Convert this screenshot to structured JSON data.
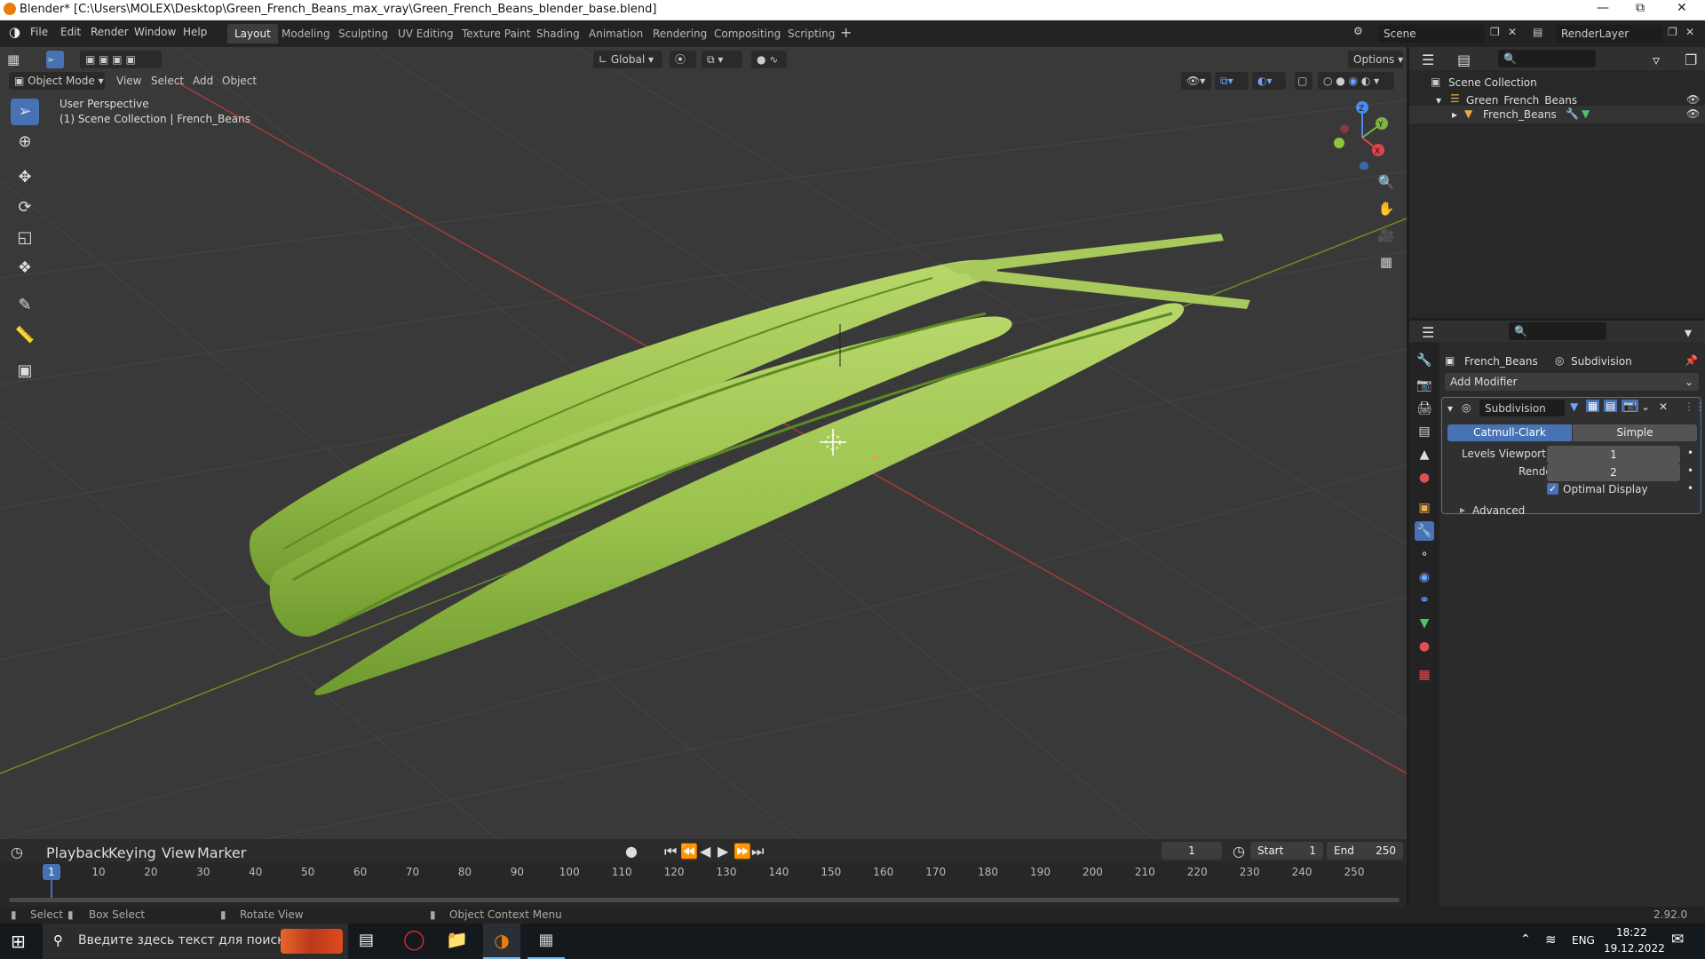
{
  "titlebar": {
    "title": "Blender* [C:\\Users\\MOLEX\\Desktop\\Green_French_Beans_max_vray\\Green_French_Beans_blender_base.blend]"
  },
  "menu": [
    "File",
    "Edit",
    "Render",
    "Window",
    "Help"
  ],
  "workspaces": [
    {
      "label": "Layout",
      "active": true
    },
    {
      "label": "Modeling"
    },
    {
      "label": "Sculpting"
    },
    {
      "label": "UV Editing"
    },
    {
      "label": "Texture Paint"
    },
    {
      "label": "Shading"
    },
    {
      "label": "Animation"
    },
    {
      "label": "Rendering"
    },
    {
      "label": "Compositing"
    },
    {
      "label": "Scripting"
    }
  ],
  "scene": {
    "scene_name": "Scene",
    "layer_name": "RenderLayer"
  },
  "viewport": {
    "mode": "Object Mode",
    "menus": [
      "View",
      "Select",
      "Add",
      "Object"
    ],
    "transform_orientation": "Global",
    "options_label": "Options",
    "overlay_line1": "User Perspective",
    "overlay_line2": "(1) Scene Collection | French_Beans",
    "gizmo": {
      "x": "X",
      "y": "Y",
      "z": "Z"
    },
    "colors": {
      "grid_x": "#a83a3a",
      "grid_y": "#6b8e23",
      "bean": "#9bc24d",
      "bean_dark": "#6f9a2f",
      "bean_light": "#b8d76b",
      "background": "#393939"
    }
  },
  "outliner": {
    "root": "Scene Collection",
    "collection": "Green_French_Beans",
    "object": "French_Beans"
  },
  "properties": {
    "object_name": "French_Beans",
    "modifier_breadcrumb": "Subdivision",
    "add_modifier": "Add Modifier",
    "modifier": {
      "name": "Subdivision",
      "type_options": [
        "Catmull-Clark",
        "Simple"
      ],
      "selected_type": "Catmull-Clark",
      "levels_viewport_label": "Levels Viewport",
      "levels_viewport_value": "1",
      "render_label": "Render",
      "render_value": "2",
      "optimal_display_label": "Optimal Display",
      "optimal_display_checked": true,
      "advanced_label": "Advanced"
    },
    "accent": "#4772b3"
  },
  "timeline": {
    "menus": [
      "Playback",
      "Keying",
      "View",
      "Marker"
    ],
    "current_frame": "1",
    "start_label": "Start",
    "start": "1",
    "end_label": "End",
    "end": "250",
    "ticks": [
      "1",
      "10",
      "20",
      "30",
      "40",
      "50",
      "60",
      "70",
      "80",
      "90",
      "100",
      "110",
      "120",
      "130",
      "140",
      "150",
      "160",
      "170",
      "180",
      "190",
      "200",
      "210",
      "220",
      "230",
      "240",
      "250"
    ]
  },
  "statusbar": {
    "select": "Select",
    "box_select": "Box Select",
    "rotate": "Rotate View",
    "context": "Object Context Menu",
    "version": "2.92.0"
  },
  "taskbar": {
    "search_placeholder": "Введите здесь текст для поиска",
    "lang": "ENG",
    "time": "18:22",
    "date": "19.12.2022"
  }
}
